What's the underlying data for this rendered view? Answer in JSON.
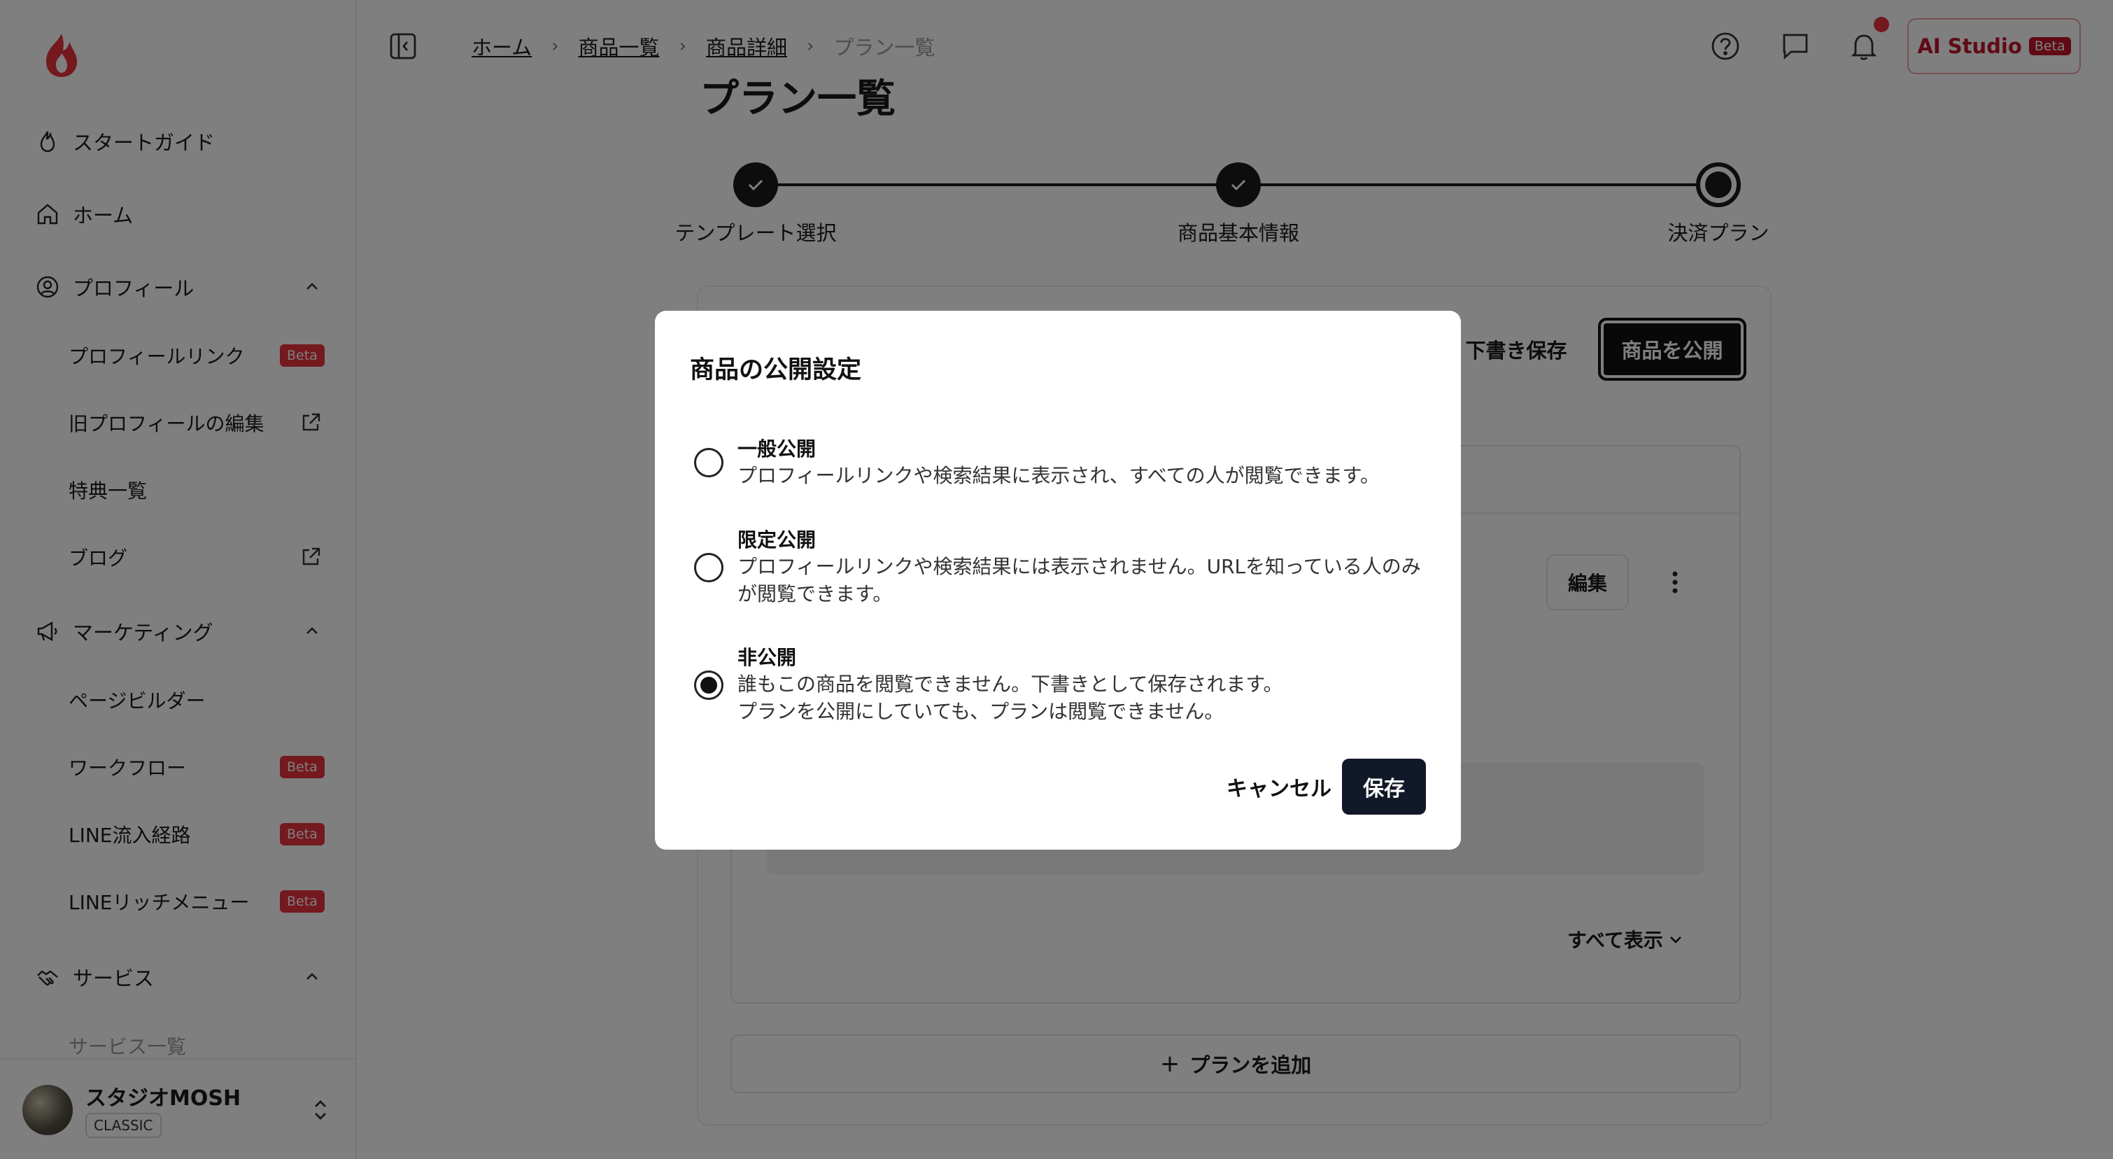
{
  "sidebar": {
    "items": [
      {
        "label": "スタートガイド"
      },
      {
        "label": "ホーム"
      },
      {
        "label": "プロフィール"
      },
      {
        "label": "プロフィールリンク",
        "badge": "Beta"
      },
      {
        "label": "旧プロフィールの編集"
      },
      {
        "label": "特典一覧"
      },
      {
        "label": "ブログ"
      },
      {
        "label": "マーケティング"
      },
      {
        "label": "ページビルダー"
      },
      {
        "label": "ワークフロー",
        "badge": "Beta"
      },
      {
        "label": "LINE流入経路",
        "badge": "Beta"
      },
      {
        "label": "LINEリッチメニュー",
        "badge": "Beta"
      },
      {
        "label": "サービス"
      },
      {
        "label": "サービス一覧"
      }
    ],
    "user": {
      "name": "スタジオMOSH",
      "plan": "CLASSIC"
    }
  },
  "header": {
    "breadcrumbs": [
      "ホーム",
      "商品一覧",
      "商品詳細"
    ],
    "breadcrumb_current": "プラン一覧",
    "ai_studio": "AI Studio",
    "ai_badge": "Beta"
  },
  "main": {
    "title": "プラン一覧",
    "steps": [
      "テンプレート選択",
      "商品基本情報",
      "決済プラン"
    ],
    "draft_save": "下書き保存",
    "publish": "商品を公開",
    "edit": "編集",
    "show_all": "すべて表示",
    "add_plan": "プランを追加"
  },
  "modal": {
    "title": "商品の公開設定",
    "options": [
      {
        "title": "一般公開",
        "desc": "プロフィールリンクや検索結果に表示され、すべての人が閲覧できます。",
        "checked": false
      },
      {
        "title": "限定公開",
        "desc": "プロフィールリンクや検索結果には表示されません。URLを知っている人のみが閲覧できます。",
        "checked": false
      },
      {
        "title": "非公開",
        "desc": "誰もこの商品を閲覧できません。下書きとして保存されます。",
        "desc2": "プランを公開にしていても、プランは閲覧できません。",
        "checked": true
      }
    ],
    "cancel": "キャンセル",
    "save": "保存"
  },
  "colors": {
    "accent": "#111827",
    "brand": "#e8323c",
    "overlay": "rgba(0,0,0,0.5)"
  },
  "icons": [
    "flame-logo-icon",
    "flame-icon",
    "home-icon",
    "user-circle-icon",
    "megaphone-icon",
    "handshake-icon",
    "external-link-icon",
    "chevron-up-icon",
    "sidebar-toggle-icon",
    "help-icon",
    "chat-icon",
    "bell-icon",
    "check-icon",
    "kebab-icon",
    "chevron-down-icon",
    "chevron-updown-icon"
  ]
}
